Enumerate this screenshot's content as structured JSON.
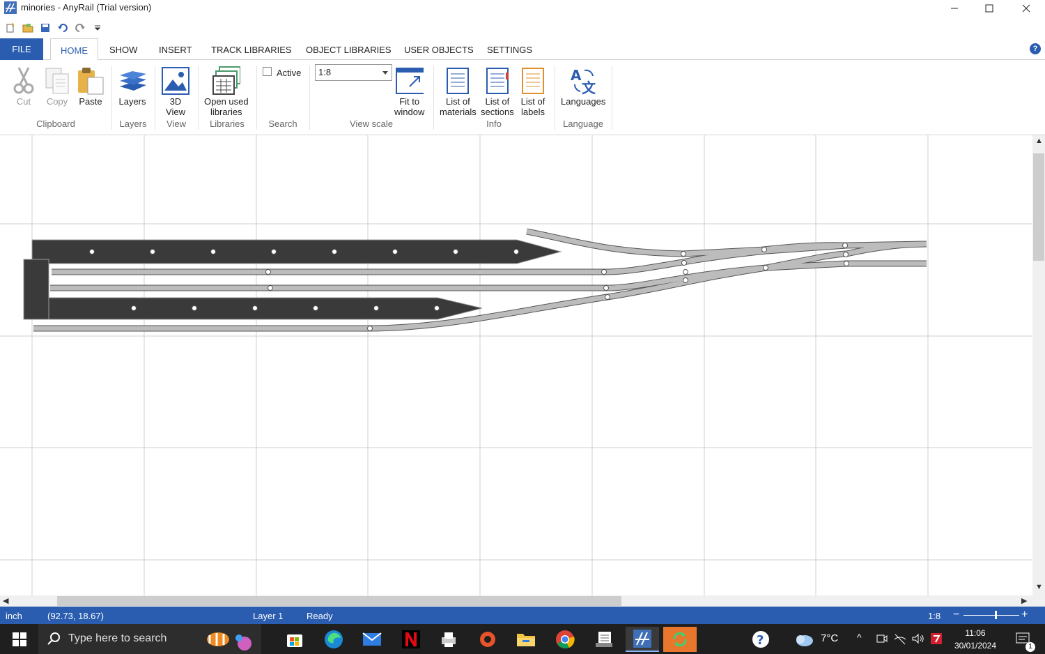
{
  "window": {
    "title": "minories - AnyRail (Trial version)",
    "controls": [
      "minimize",
      "maximize",
      "close"
    ]
  },
  "tabs": {
    "file": "FILE",
    "items": [
      "HOME",
      "SHOW",
      "INSERT",
      "TRACK LIBRARIES",
      "OBJECT LIBRARIES",
      "USER OBJECTS",
      "SETTINGS"
    ]
  },
  "ribbon": {
    "cut": "Cut",
    "copy": "Copy",
    "paste": "Paste",
    "clipboard_group": "Clipboard",
    "layers": "Layers",
    "layers_group": "Layers",
    "view3d_1": "3D",
    "view3d_2": "View",
    "view_group": "View",
    "open_used_1": "Open used",
    "open_used_2": "libraries",
    "libraries_group": "Libraries",
    "active_label": "Active",
    "search_group": "Search",
    "scale_value": "1:8",
    "fit_1": "Fit to",
    "fit_2": "window",
    "viewscale_group": "View scale",
    "materials_1": "List of",
    "materials_2": "materials",
    "sections_1": "List of",
    "sections_2": "sections",
    "labels_1": "List of",
    "labels_2": "labels",
    "info_group": "Info",
    "languages": "Languages",
    "language_group": "Language"
  },
  "status": {
    "unit": "inch",
    "coords": "(92.73, 18.67)",
    "layer": "Layer 1",
    "state": "Ready",
    "zoom": "1:8"
  },
  "taskbar": {
    "search_placeholder": "Type here to search",
    "temperature": "7°C",
    "time": "11:06",
    "date": "30/01/2024",
    "notification_count": "1"
  },
  "colors": {
    "accent": "#2a5db0",
    "platform": "#3a3a3a",
    "track": "#b8b8b8"
  }
}
